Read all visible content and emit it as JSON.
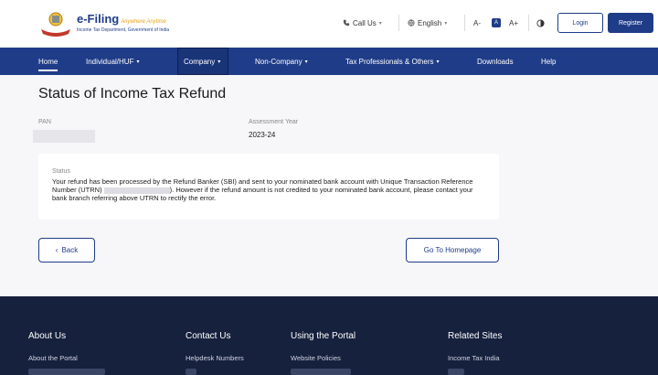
{
  "header": {
    "logo": {
      "title": "e-Filing",
      "tagline": "Anywhere Anytime",
      "subtitle": "Income Tax Department, Government of India"
    },
    "call_us": "Call Us",
    "language": "English",
    "font_decrease": "A-",
    "font_normal": "A",
    "font_increase": "A+",
    "login": "Login",
    "register": "Register"
  },
  "nav": {
    "items": [
      {
        "label": "Home",
        "chevron": false
      },
      {
        "label": "Individual/HUF",
        "chevron": true
      },
      {
        "label": "Company",
        "chevron": true
      },
      {
        "label": "Non-Company",
        "chevron": true
      },
      {
        "label": "Tax Professionals & Others",
        "chevron": true
      },
      {
        "label": "Downloads",
        "chevron": false
      },
      {
        "label": "Help",
        "chevron": false
      }
    ]
  },
  "main": {
    "title": "Status of Income Tax Refund",
    "pan_label": "PAN",
    "ay_label": "Assessment Year",
    "ay_value": "2023-24",
    "status_label": "Status",
    "status_text_1": "Your refund has been processed by the Refund Banker (SBI) and sent to your nominated bank account with Unique Transaction Reference Number (UTRN) ",
    "status_text_2": "). However if the refund amount is not credited to your nominated bank account, please contact your bank branch referring above UTRN to rectify the error.",
    "back_label": "Back",
    "home_label": "Go To Homepage"
  },
  "footer": {
    "columns": [
      {
        "heading": "About Us",
        "link": "About the Portal"
      },
      {
        "heading": "Contact Us",
        "link": "Helpdesk Numbers"
      },
      {
        "heading": "Using the Portal",
        "link": "Website Policies"
      },
      {
        "heading": "Related Sites",
        "link": "Income Tax India"
      }
    ]
  },
  "colors": {
    "primary": "#1f3c88",
    "footer_bg": "#16213e",
    "page_bg": "#f7f7f9"
  }
}
